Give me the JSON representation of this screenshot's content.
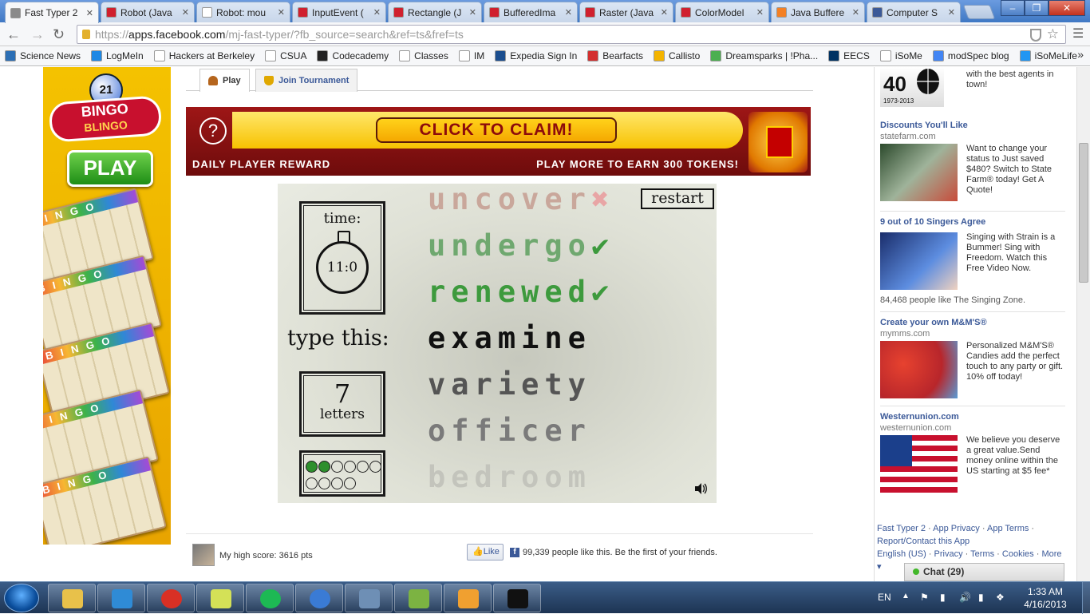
{
  "browser": {
    "tabs": [
      {
        "label": "Fast Typer 2",
        "icon": "fast-typer-favicon",
        "color": "#8a8a8a",
        "active": true
      },
      {
        "label": "Robot (Java",
        "icon": "oracle-favicon",
        "color": "#d0202e"
      },
      {
        "label": "Robot: mou",
        "icon": "page-favicon",
        "color": "#ffffff"
      },
      {
        "label": "InputEvent (",
        "icon": "oracle-favicon",
        "color": "#d0202e"
      },
      {
        "label": "Rectangle (J",
        "icon": "oracle-favicon",
        "color": "#d0202e"
      },
      {
        "label": "BufferedIma",
        "icon": "oracle-favicon",
        "color": "#d0202e"
      },
      {
        "label": "Raster (Java",
        "icon": "oracle-favicon",
        "color": "#d0202e"
      },
      {
        "label": "ColorModel",
        "icon": "oracle-favicon",
        "color": "#d0202e"
      },
      {
        "label": "Java Buffere",
        "icon": "stackoverflow-favicon",
        "color": "#f48024"
      },
      {
        "label": "Computer S",
        "icon": "facebook-favicon",
        "color": "#3b5998"
      }
    ],
    "url_scheme": "https://",
    "url_host": "apps.facebook.com",
    "url_path": "/mj-fast-typer/?fb_source=search&ref=ts&fref=ts",
    "bookmarks": [
      {
        "label": "Science News",
        "color": "#2c6fb5"
      },
      {
        "label": "LogMeIn",
        "color": "#1e88e5"
      },
      {
        "label": "Hackers at Berkeley",
        "color": "#ffffff"
      },
      {
        "label": "CSUA",
        "color": "#ffffff"
      },
      {
        "label": "Codecademy",
        "color": "#222222"
      },
      {
        "label": "Classes",
        "color": "#ffffff"
      },
      {
        "label": "IM",
        "color": "#ffffff"
      },
      {
        "label": "Expedia Sign In",
        "color": "#1b4e8f"
      },
      {
        "label": "Bearfacts",
        "color": "#d32f2f"
      },
      {
        "label": "Callisto",
        "color": "#f4b400"
      },
      {
        "label": "Dreamsparks | !Pha...",
        "color": "#4caf50"
      },
      {
        "label": "EECS",
        "color": "#003262"
      },
      {
        "label": "iSoMe",
        "color": "#ffffff"
      },
      {
        "label": "modSpec blog",
        "color": "#4285f4"
      },
      {
        "label": "iSoMeLife",
        "color": "#2196f3"
      }
    ]
  },
  "app": {
    "tabs": [
      {
        "label": "Play",
        "icon": "person-icon",
        "color": "#b5651d"
      },
      {
        "label": "Join Tournament",
        "icon": "trophy-icon",
        "color": "#e0a800"
      }
    ]
  },
  "banner": {
    "help": "?",
    "claim": "CLICK TO CLAIM!",
    "daily": "DAILY PLAYER REWARD",
    "earn": "PLAY MORE TO EARN 300 TOKENS!"
  },
  "left_ad": {
    "logo_top": "BINGO",
    "logo_bottom": "BLINGO",
    "ball_number": "21",
    "play": "PLAY",
    "card_header": "BINGO"
  },
  "game": {
    "time_label": "time:",
    "time_value": "11:0",
    "prompt": "type this:",
    "restart": "restart",
    "letters_count": "7",
    "letters_label": "letters",
    "progress_dots": {
      "total": 10,
      "filled": 2
    },
    "words": [
      {
        "text": "uncover",
        "status": "wrong",
        "color": "#c9a79b"
      },
      {
        "text": "undergo",
        "status": "correct",
        "color": "#6fa86f"
      },
      {
        "text": "renewed",
        "status": "correct",
        "color": "#3d9a3d"
      },
      {
        "text": "examine",
        "status": "current",
        "color": "#111111"
      },
      {
        "text": "variety",
        "status": "upcoming",
        "color": "#555555"
      },
      {
        "text": "officer",
        "status": "upcoming",
        "color": "#7a7a7a"
      },
      {
        "text": "bedroom",
        "status": "upcoming",
        "color": "#c3c4bc"
      }
    ]
  },
  "footer": {
    "high_score": "My high score: 3616 pts",
    "like_button": "Like",
    "likes_text": "99,339 people like this. Be the first of your friends."
  },
  "sidebar": {
    "partial_ad_text": "with the best agents in town!",
    "partial_ad_years": "1973-2013",
    "ads": [
      {
        "title": "Discounts You'll Like",
        "domain": "statefarm.com",
        "text": "Want to change your status to Just saved $480? Switch to State Farm® today! Get A Quote!",
        "social": ""
      },
      {
        "title": "9 out of 10 Singers Agree",
        "domain": "",
        "text": "Singing with Strain is a Bummer! Sing with Freedom. Watch this Free Video Now.",
        "social": "84,468 people like The Singing Zone."
      },
      {
        "title": "Create your own M&M'S®",
        "domain": "mymms.com",
        "text": "Personalized M&M'S® Candies add the perfect touch to any party or gift. 10% off today!",
        "social": ""
      },
      {
        "title": "Westernunion.com",
        "domain": "westernunion.com",
        "text": "We believe you deserve a great value.Send money online within the US starting at $5 fee*",
        "social": ""
      }
    ],
    "footer_links": [
      "Fast Typer 2",
      "App Privacy",
      "App Terms",
      "Report/Contact this App"
    ],
    "footer_links2": [
      "English (US)",
      "Privacy",
      "Terms",
      "Cookies",
      "More ▾"
    ],
    "chat": "Chat (29)"
  },
  "taskbar": {
    "language": "EN",
    "time": "1:33 AM",
    "date": "4/16/2013"
  }
}
